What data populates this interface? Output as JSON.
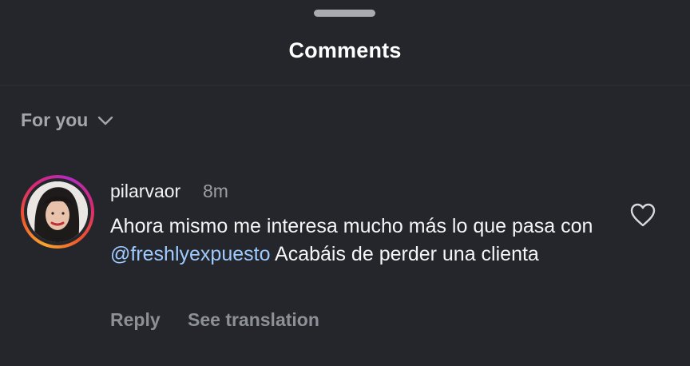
{
  "header": {
    "title": "Comments"
  },
  "filter": {
    "label": "For you"
  },
  "comment": {
    "username": "pilarvaor",
    "time": "8m",
    "text_part1": "Ahora mismo me interesa mucho más lo que pasa con ",
    "mention": "@freshlyexpuesto",
    "text_part2": " Acabáis de perder una clienta",
    "reply_label": "Reply",
    "translate_label": "See translation"
  },
  "icons": {
    "filter": "chevron-down-icon",
    "like": "heart-outline-icon"
  },
  "colors": {
    "background": "#24262c",
    "mention": "#9ecbff",
    "secondary_text": "#8d9097"
  }
}
